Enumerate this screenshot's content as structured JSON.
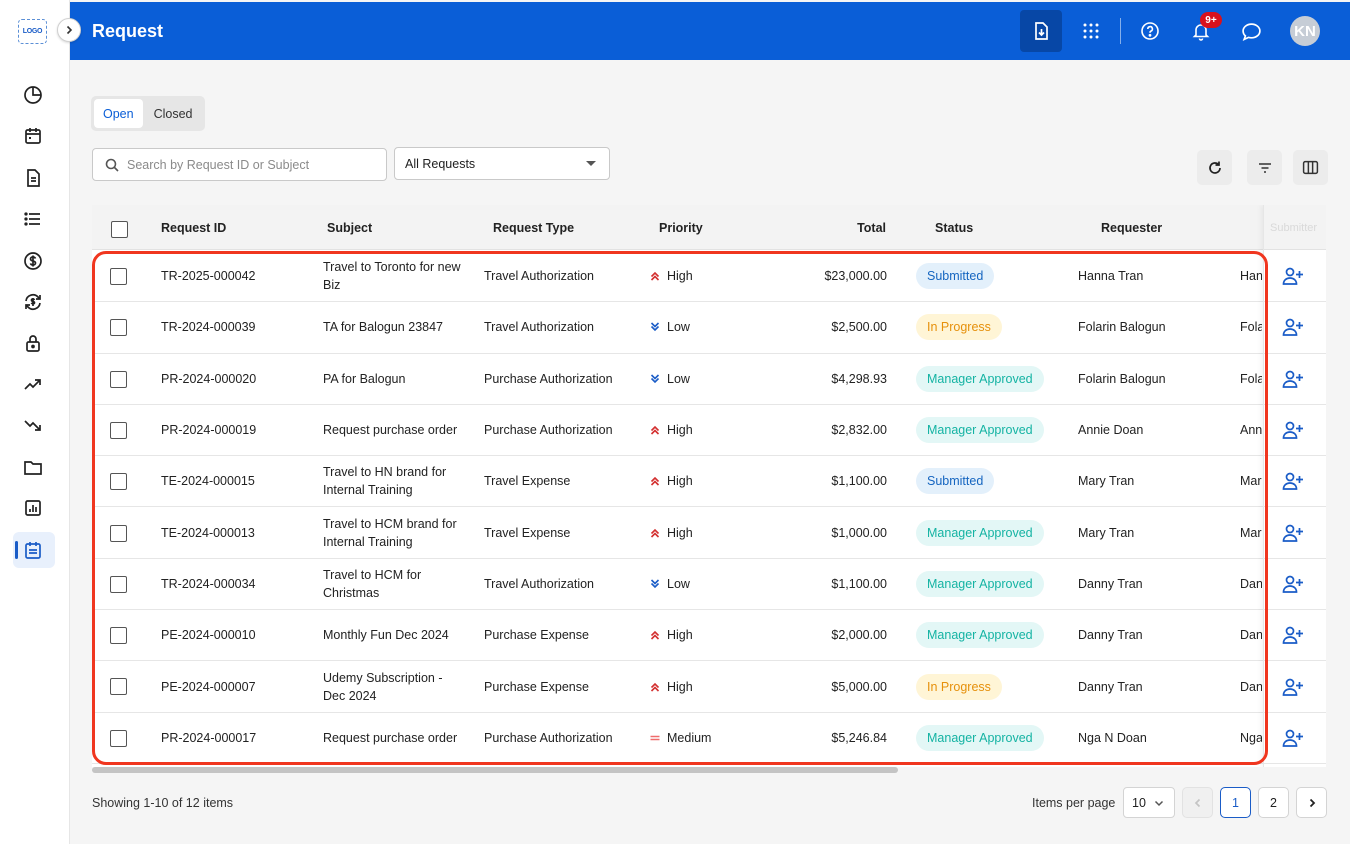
{
  "app": {
    "logo_text": "LOGO",
    "page_title": "Request",
    "notification_count": "9+",
    "avatar_initials": "KN"
  },
  "sidebar": {
    "items": [
      {
        "icon": "pie-chart-icon"
      },
      {
        "icon": "calendar-icon"
      },
      {
        "icon": "document-icon"
      },
      {
        "icon": "list-icon"
      },
      {
        "icon": "dollar-icon"
      },
      {
        "icon": "dollar-exchange-icon"
      },
      {
        "icon": "lock-icon"
      },
      {
        "icon": "trend-up-icon"
      },
      {
        "icon": "trend-down-icon"
      },
      {
        "icon": "folder-icon"
      },
      {
        "icon": "report-chart-icon"
      },
      {
        "icon": "request-list-icon",
        "active": true
      }
    ]
  },
  "tabs": [
    {
      "label": "Open",
      "active": true
    },
    {
      "label": "Closed",
      "active": false
    }
  ],
  "filters": {
    "search_placeholder": "Search by Request ID or Subject",
    "search_value": "",
    "request_type_selected": "All Requests"
  },
  "table": {
    "columns": {
      "request_id": "Request ID",
      "subject": "Subject",
      "request_type": "Request Type",
      "priority": "Priority",
      "total": "Total",
      "status": "Status",
      "requester": "Requester",
      "submitter": "Submitter"
    },
    "rows": [
      {
        "request_id": "TR-2025-000042",
        "subject": "Travel to Toronto for new Biz",
        "request_type": "Travel Authorization",
        "priority": "High",
        "total": "$23,000.00",
        "status": "Submitted",
        "requester": "Hanna Tran",
        "submitter_clip": "Han"
      },
      {
        "request_id": "TR-2024-000039",
        "subject": "TA for Balogun 23847",
        "request_type": "Travel Authorization",
        "priority": "Low",
        "total": "$2,500.00",
        "status": "In Progress",
        "requester": "Folarin Balogun",
        "submitter_clip": "Fola"
      },
      {
        "request_id": "PR-2024-000020",
        "subject": "PA for Balogun",
        "request_type": "Purchase Authorization",
        "priority": "Low",
        "total": "$4,298.93",
        "status": "Manager Approved",
        "requester": "Folarin Balogun",
        "submitter_clip": "Fola"
      },
      {
        "request_id": "PR-2024-000019",
        "subject": "Request purchase order",
        "request_type": "Purchase Authorization",
        "priority": "High",
        "total": "$2,832.00",
        "status": "Manager Approved",
        "requester": "Annie Doan",
        "submitter_clip": "Anni"
      },
      {
        "request_id": "TE-2024-000015",
        "subject": "Travel to HN brand for Internal Training",
        "request_type": "Travel Expense",
        "priority": "High",
        "total": "$1,100.00",
        "status": "Submitted",
        "requester": "Mary Tran",
        "submitter_clip": "Mar"
      },
      {
        "request_id": "TE-2024-000013",
        "subject": "Travel to HCM brand for Internal Training",
        "request_type": "Travel Expense",
        "priority": "High",
        "total": "$1,000.00",
        "status": "Manager Approved",
        "requester": "Mary Tran",
        "submitter_clip": "Mar"
      },
      {
        "request_id": "TR-2024-000034",
        "subject": "Travel to HCM for Christmas",
        "request_type": "Travel Authorization",
        "priority": "Low",
        "total": "$1,100.00",
        "status": "Manager Approved",
        "requester": "Danny Tran",
        "submitter_clip": "Dan"
      },
      {
        "request_id": "PE-2024-000010",
        "subject": "Monthly Fun Dec 2024",
        "request_type": "Purchase Expense",
        "priority": "High",
        "total": "$2,000.00",
        "status": "Manager Approved",
        "requester": "Danny Tran",
        "submitter_clip": "Dan"
      },
      {
        "request_id": "PE-2024-000007",
        "subject": "Udemy Subscription - Dec 2024",
        "request_type": "Purchase Expense",
        "priority": "High",
        "total": "$5,000.00",
        "status": "In Progress",
        "requester": "Danny Tran",
        "submitter_clip": "Dan"
      },
      {
        "request_id": "PR-2024-000017",
        "subject": "Request purchase order",
        "request_type": "Purchase Authorization",
        "priority": "Medium",
        "total": "$5,246.84",
        "status": "Manager Approved",
        "requester": "Nga N Doan",
        "submitter_clip": "Nga"
      }
    ]
  },
  "footer": {
    "showing_text": "Showing 1-10 of 12 items",
    "items_per_page_label": "Items per page",
    "items_per_page_value": "10",
    "pages": [
      "1",
      "2"
    ],
    "current_page": "1"
  },
  "colors": {
    "header_bg": "#0a5ed7",
    "priority_high": "#d32f2f",
    "priority_low": "#1a5cc7",
    "priority_medium": "#ef6c6c",
    "status_submitted": "#1565c0",
    "status_in_progress": "#e6900b",
    "status_manager_approved": "#14b3a3",
    "highlight_border": "#f0361f"
  }
}
